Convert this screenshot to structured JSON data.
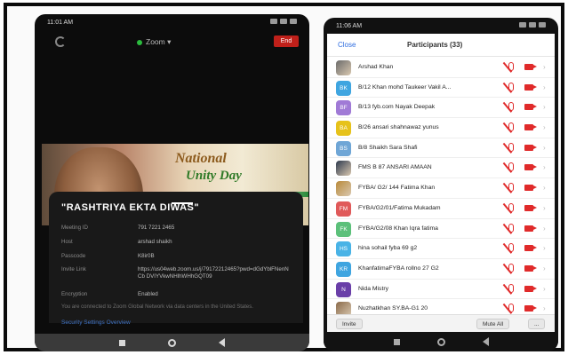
{
  "phone1": {
    "status_time": "11:01 AM",
    "header": {
      "app_label": "Zoom",
      "end_label": "End"
    },
    "banner": {
      "line1": "National",
      "line2": "Unity Day"
    },
    "meeting": {
      "title": "\"RASHTRIYA EKTA DIWAS\"",
      "rows": [
        {
          "label": "Meeting ID",
          "value": "791 7221 2465"
        },
        {
          "label": "Host",
          "value": "arshad shaikh"
        },
        {
          "label": "Passcode",
          "value": "K8ir0B"
        },
        {
          "label": "Invite Link",
          "value": "https://us04web.zoom.us/j/79172212465?pwd=dGdYblFNenNCb DVIYVkwNHlhWHhGQT09"
        },
        {
          "label": "Encryption",
          "value": "Enabled"
        }
      ],
      "note": "You are connected to Zoom Global Network via data centers in the United States.",
      "security_link": "Security Settings Overview"
    }
  },
  "phone2": {
    "status_time": "11:06 AM",
    "header": {
      "close_label": "Close",
      "title": "Participants (33)"
    },
    "participants": [
      {
        "initials": "",
        "name": "Arshad Khan",
        "color": "#6b6b6b",
        "photo": true
      },
      {
        "initials": "BK",
        "name": "B/12 Khan mohd Taukeer Vakil A...",
        "color": "#3fa5e0"
      },
      {
        "initials": "BF",
        "name": "B/13 fyb.com Nayak Deepak",
        "color": "#a07ad6"
      },
      {
        "initials": "BA",
        "name": "B/26 ansari shahnawaz yunus",
        "color": "#e6c21b"
      },
      {
        "initials": "BS",
        "name": "B/8 Shaikh Sara Shafi",
        "color": "#6fa6d6"
      },
      {
        "initials": "",
        "name": "FMS B 87 ANSARI AMAAN",
        "color": "#2e3a4e",
        "photo": true
      },
      {
        "initials": "",
        "name": "FYBA/ G2/ 144 Fatima Khan",
        "color": "#b98a3a",
        "photo": true
      },
      {
        "initials": "FM",
        "name": "FYBA/G2/01/Fatima Mukadam",
        "color": "#e05a5a"
      },
      {
        "initials": "FK",
        "name": "FYBA/G2/08 Khan Iqra fatima",
        "color": "#5cc07a"
      },
      {
        "initials": "HS",
        "name": "hina sohail fyba 69 g2",
        "color": "#49b3e6"
      },
      {
        "initials": "KR",
        "name": "KhanfatimaFYBA rollno 27 G2",
        "color": "#3fa5e0"
      },
      {
        "initials": "N",
        "name": "Nida Mistry",
        "color": "#6a3fa8"
      },
      {
        "initials": "",
        "name": "Nuzhatkhan SY.BA-G1 20",
        "color": "#8a6a4a",
        "photo": true
      }
    ],
    "footer": {
      "invite_label": "Invite",
      "mute_all_label": "Mute All",
      "more_label": "..."
    }
  }
}
